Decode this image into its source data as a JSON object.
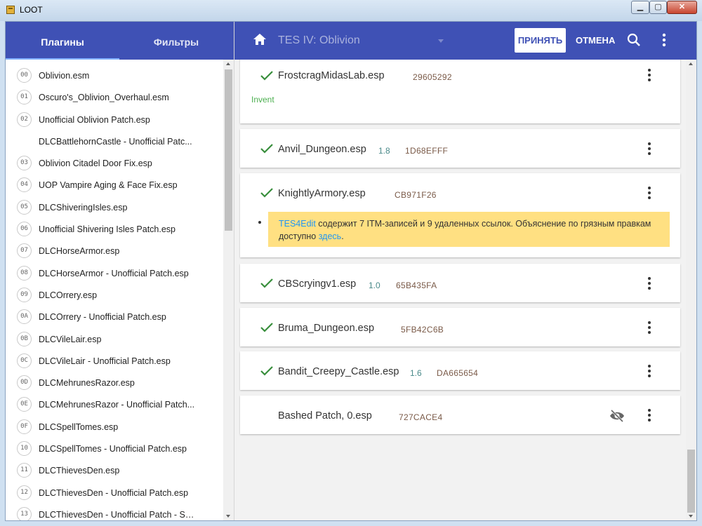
{
  "window": {
    "title": "LOOT"
  },
  "sidebar": {
    "tabs": [
      {
        "label": "Плагины"
      },
      {
        "label": "Фильтры"
      }
    ],
    "items": [
      {
        "index": "00",
        "name": "Oblivion.esm"
      },
      {
        "index": "01",
        "name": "Oscuro's_Oblivion_Overhaul.esm"
      },
      {
        "index": "02",
        "name": "Unofficial Oblivion Patch.esp"
      },
      {
        "index": "",
        "name": "DLCBattlehornCastle - Unofficial Patc..."
      },
      {
        "index": "03",
        "name": "Oblivion Citadel Door Fix.esp"
      },
      {
        "index": "04",
        "name": "UOP Vampire Aging & Face Fix.esp"
      },
      {
        "index": "05",
        "name": "DLCShiveringIsles.esp"
      },
      {
        "index": "06",
        "name": "Unofficial Shivering Isles Patch.esp"
      },
      {
        "index": "07",
        "name": "DLCHorseArmor.esp"
      },
      {
        "index": "08",
        "name": "DLCHorseArmor - Unofficial Patch.esp"
      },
      {
        "index": "09",
        "name": "DLCOrrery.esp"
      },
      {
        "index": "0A",
        "name": "DLCOrrery - Unofficial Patch.esp"
      },
      {
        "index": "0B",
        "name": "DLCVileLair.esp"
      },
      {
        "index": "0C",
        "name": "DLCVileLair - Unofficial Patch.esp"
      },
      {
        "index": "0D",
        "name": "DLCMehrunesRazor.esp"
      },
      {
        "index": "0E",
        "name": "DLCMehrunesRazor - Unofficial Patch..."
      },
      {
        "index": "0F",
        "name": "DLCSpellTomes.esp"
      },
      {
        "index": "10",
        "name": "DLCSpellTomes - Unofficial Patch.esp"
      },
      {
        "index": "11",
        "name": "DLCThievesDen.esp"
      },
      {
        "index": "12",
        "name": "DLCThievesDen - Unofficial Patch.esp"
      },
      {
        "index": "13",
        "name": "DLCThievesDen - Unofficial Patch - SS..."
      }
    ]
  },
  "header": {
    "game": "TES IV: Oblivion",
    "accept_label": "ПРИНЯТЬ",
    "cancel_label": "ОТМЕНА"
  },
  "colors": {
    "primary": "#3f51b5",
    "check": "#388e3c",
    "warning": "#ffe082",
    "link": "#2196f3",
    "tag": "#4caf50"
  },
  "plugins": [
    {
      "name": "FrostcragMidasLab.esp",
      "version": "",
      "crc": "29605292",
      "tag": "Invent",
      "checked": true
    },
    {
      "name": "Anvil_Dungeon.esp",
      "version": "1.8",
      "crc": "1D68EFFF",
      "checked": true
    },
    {
      "name": "KnightlyArmory.esp",
      "version": "",
      "crc": "CB971F26",
      "checked": true,
      "message": {
        "link1": "TES4Edit",
        "text1": " содержит 7 ITM-записей и 9 удаленных ссылок. Объяснение по грязным правкам доступно ",
        "link2": "здесь",
        "text2": "."
      }
    },
    {
      "name": "CBScryingv1.esp",
      "version": "1.0",
      "crc": "65B435FA",
      "checked": true
    },
    {
      "name": "Bruma_Dungeon.esp",
      "version": "",
      "crc": "5FB42C6B",
      "checked": true
    },
    {
      "name": "Bandit_Creepy_Castle.esp",
      "version": "1.6",
      "crc": "DA665654",
      "checked": true
    },
    {
      "name": "Bashed Patch, 0.esp",
      "version": "",
      "crc": "727CACE4",
      "checked": false,
      "hidden_icon": "eye-off-icon"
    }
  ]
}
